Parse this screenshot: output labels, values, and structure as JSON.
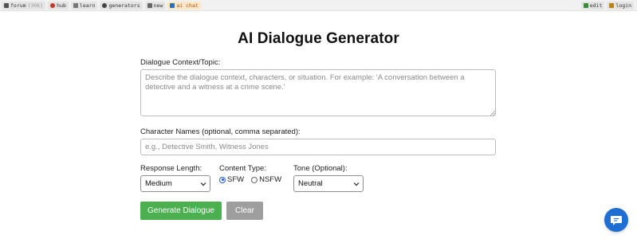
{
  "nav": {
    "left": [
      {
        "label": "forum",
        "suffix": "(30k)"
      },
      {
        "label": "hub"
      },
      {
        "label": "learn"
      },
      {
        "label": "generators"
      },
      {
        "label": "new"
      },
      {
        "label": "ai chat",
        "active": true
      }
    ],
    "right": [
      {
        "label": "edit"
      },
      {
        "label": "login"
      }
    ]
  },
  "page": {
    "title": "AI Dialogue Generator"
  },
  "form": {
    "context_label": "Dialogue Context/Topic:",
    "context_placeholder": "Describe the dialogue context, characters, or situation. For example: 'A conversation between a detective and a witness at a crime scene.'",
    "names_label": "Character Names (optional, comma separated):",
    "names_placeholder": "e.g., Detective Smith, Witness Jones",
    "length_label": "Response Length:",
    "length_value": "Medium",
    "content_label": "Content Type:",
    "content_options": [
      "SFW",
      "NSFW"
    ],
    "content_selected": "SFW",
    "tone_label": "Tone (Optional):",
    "tone_value": "Neutral",
    "generate_label": "Generate Dialogue",
    "clear_label": "Clear"
  },
  "colors": {
    "generate": "#4caf50",
    "clear": "#9e9e9e",
    "chat": "#1f6ed4",
    "active_tab": "#fde7c8"
  },
  "icons": [
    "forum-icon",
    "hub-icon",
    "learn-icon",
    "generators-icon",
    "new-icon",
    "ai-chat-icon",
    "edit-icon",
    "login-icon",
    "chat-bubble-icon"
  ]
}
